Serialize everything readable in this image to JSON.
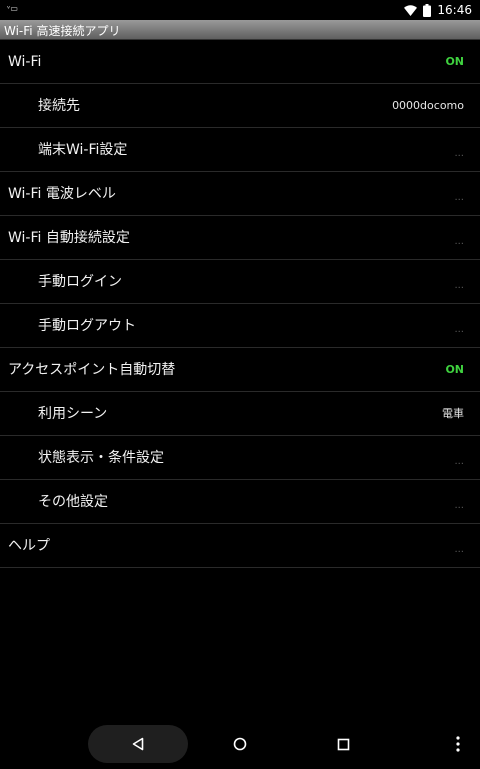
{
  "status_bar": {
    "sim_indicator": "ᵛ▭",
    "time": "16:46",
    "icons": [
      "wifi-icon",
      "battery-icon"
    ]
  },
  "app_title": "Wi-Fi 高速接続アプリ",
  "settings": [
    {
      "label": "Wi-Fi",
      "value": "ON",
      "level": 0,
      "value_type": "on"
    },
    {
      "label": "接続先",
      "value": "0000docomo",
      "level": 1,
      "value_type": "text"
    },
    {
      "label": "端末Wi-Fi設定",
      "value": "...",
      "level": 1,
      "value_type": "more"
    },
    {
      "label": "Wi-Fi 電波レベル",
      "value": "...",
      "level": 0,
      "value_type": "more"
    },
    {
      "label": "Wi-Fi 自動接続設定",
      "value": "...",
      "level": 0,
      "value_type": "more"
    },
    {
      "label": "手動ログイン",
      "value": "...",
      "level": 1,
      "value_type": "more"
    },
    {
      "label": "手動ログアウト",
      "value": "...",
      "level": 1,
      "value_type": "more"
    },
    {
      "label": "アクセスポイント自動切替",
      "value": "ON",
      "level": 0,
      "value_type": "on"
    },
    {
      "label": "利用シーン",
      "value": "電車",
      "level": 1,
      "value_type": "text"
    },
    {
      "label": "状態表示・条件設定",
      "value": "...",
      "level": 1,
      "value_type": "more"
    },
    {
      "label": "その他設定",
      "value": "...",
      "level": 1,
      "value_type": "more"
    },
    {
      "label": "ヘルプ",
      "value": "...",
      "level": 0,
      "value_type": "more"
    }
  ],
  "nav_bar": {
    "buttons": [
      "back-icon",
      "home-icon",
      "recents-icon",
      "menu-icon"
    ]
  },
  "colors": {
    "background": "#000000",
    "on_accent": "#3fd13f",
    "title_bar": "#7a7a7a",
    "divider": "#2a2a2a"
  }
}
